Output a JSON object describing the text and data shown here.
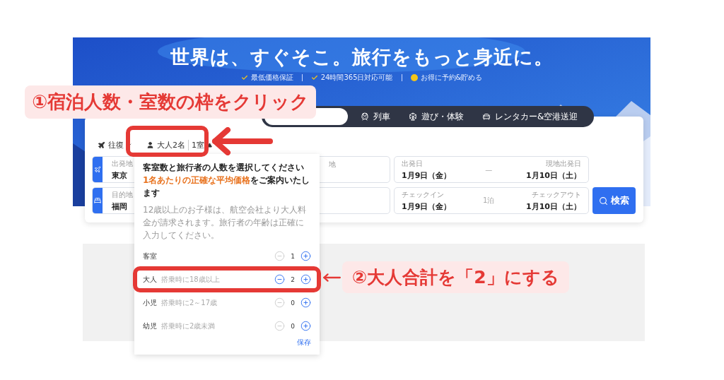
{
  "hero": {
    "headline": "世界は、すぐそこ。旅行をもっと身近に。",
    "features": [
      {
        "kind": "check",
        "text": "最低価格保証"
      },
      {
        "kind": "check",
        "text": "24時間365日対応可能"
      },
      {
        "kind": "coin",
        "text": "お得に予約&貯める"
      }
    ]
  },
  "tabs": [
    {
      "kind": "hotel",
      "selected": true
    },
    {
      "kind": "train",
      "label": "列車",
      "selected": false
    },
    {
      "kind": "activity",
      "label": "遊び・体験",
      "selected": false
    },
    {
      "kind": "car",
      "label": "レンタカー&空港送迎",
      "selected": false
    }
  ],
  "options": {
    "trip_type": "往復",
    "guests": "大人2名",
    "rooms": "1室",
    "expanded": true
  },
  "rows": [
    {
      "kind": "flight",
      "origin_label": "出発地",
      "origin": "東京",
      "dest_label": "地",
      "from_label": "出発日",
      "from": "1月9日（金）",
      "middle": "—",
      "to_label": "現地出発日",
      "to": "1月10日（土）"
    },
    {
      "kind": "hotel",
      "origin_label": "目的地",
      "origin": "福岡",
      "from_label": "チェックイン",
      "from": "1月9日（金）",
      "middle": "1泊",
      "to_label": "チェックアウト",
      "to": "1月10日（土）"
    }
  ],
  "search_button": "検索",
  "dropdown": {
    "intro": "客室数と旅行者の人数を選択してください",
    "highlight": "1名あたりの正確な平均価格",
    "intro_tail": "をご案内いたします",
    "note": "12歳以上のお子様は、航空会社より大人料金が請求されます。旅行者の年齢は正確に入力してください。",
    "counters": [
      {
        "label": "客室",
        "count": "1",
        "minus_disabled": true
      },
      {
        "label": "大人",
        "hint": "搭乗時に18歳以上",
        "count": "2",
        "minus_disabled": false
      },
      {
        "label": "小児",
        "hint": "搭乗時に2～17歳",
        "count": "0",
        "minus_disabled": true
      },
      {
        "label": "幼児",
        "hint": "搭乗時に2歳未満",
        "count": "0",
        "minus_disabled": true
      }
    ],
    "save": "保存"
  },
  "annotations": [
    {
      "text": "①宿泊人数・室数の枠をクリック"
    },
    {
      "text": "②大人合計を「2」にする"
    }
  ]
}
